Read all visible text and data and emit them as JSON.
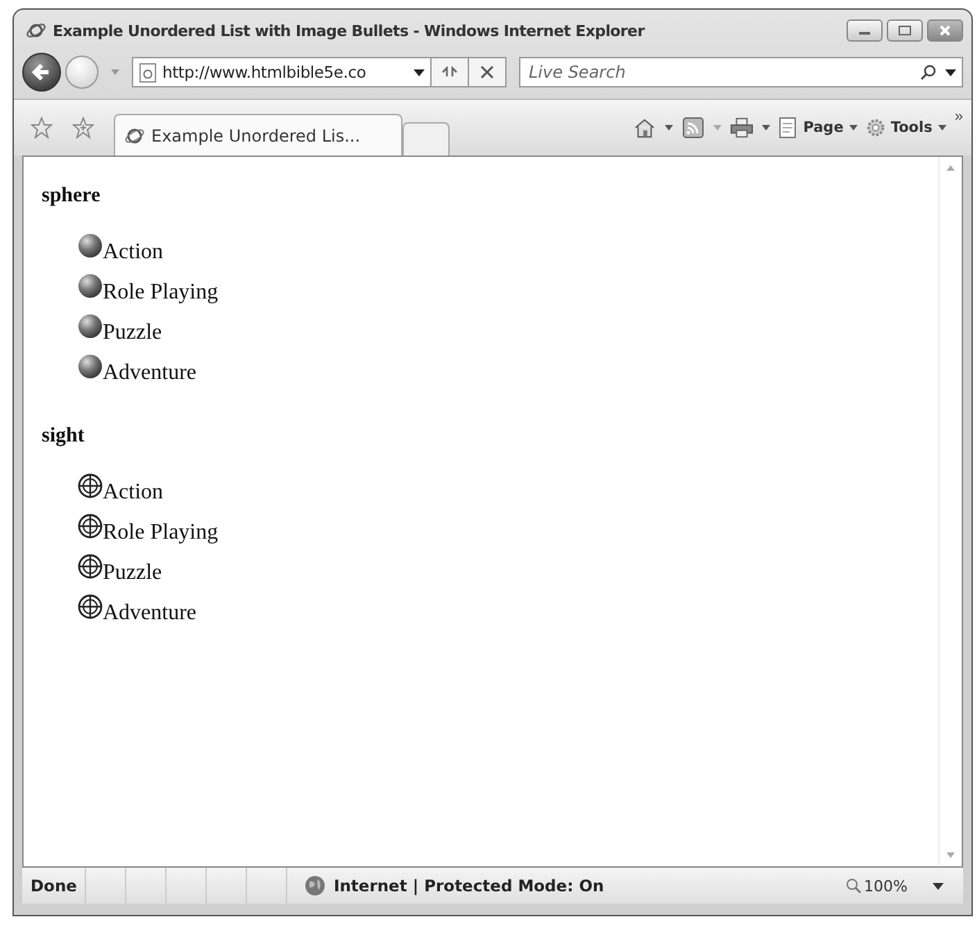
{
  "window": {
    "title": "Example Unordered List with Image Bullets - Windows Internet Explorer"
  },
  "address_bar": {
    "value": "http://www.htmlbible5e.co"
  },
  "search": {
    "placeholder": "Live Search"
  },
  "tabs": [
    {
      "label": "Example Unordered Lis...",
      "selected": true
    }
  ],
  "command_bar": {
    "page": "Page",
    "tools": "Tools",
    "overflow": "»"
  },
  "sections": [
    {
      "heading": "sphere",
      "kind": "sphere",
      "items": [
        "Action",
        "Role Playing",
        "Puzzle",
        "Adventure"
      ]
    },
    {
      "heading": "sight",
      "kind": "sight",
      "items": [
        "Action",
        "Role Playing",
        "Puzzle",
        "Adventure"
      ]
    }
  ],
  "status_bar": {
    "status": "Done",
    "zone": "Internet | Protected Mode: On",
    "zoom": "100%"
  }
}
